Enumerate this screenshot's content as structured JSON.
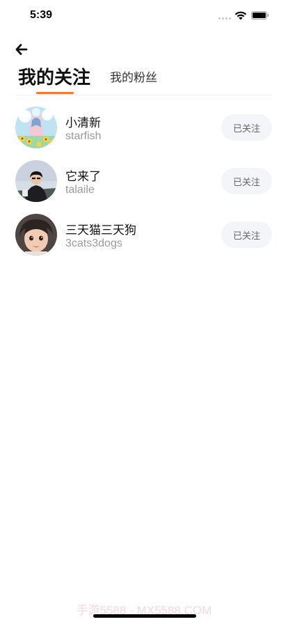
{
  "status_bar": {
    "time": "5:39"
  },
  "header": {
    "back_icon": "arrow-left-icon"
  },
  "tabs": [
    {
      "label": "我的关注",
      "active": true
    },
    {
      "label": "我的粉丝",
      "active": false
    }
  ],
  "accent_color": "#f0793b",
  "follows": [
    {
      "name": "小清新",
      "handle": "starfish",
      "button_label": "已关注"
    },
    {
      "name": "它来了",
      "handle": "talaile",
      "button_label": "已关注"
    },
    {
      "name": "三天猫三天狗",
      "handle": "3cats3dogs",
      "button_label": "已关注"
    }
  ],
  "watermark": "手游5588 · MX5588.COM"
}
